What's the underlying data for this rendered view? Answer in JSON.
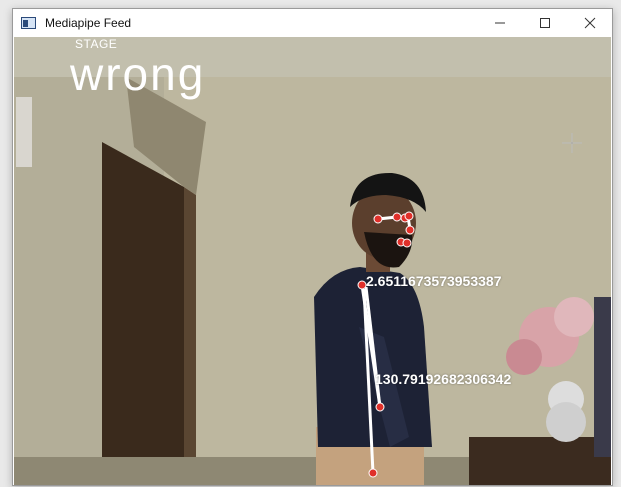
{
  "window": {
    "title": "Mediapipe Feed",
    "icon": "app-window-icon",
    "controls": [
      "minimize-icon",
      "maximize-icon",
      "close-icon"
    ]
  },
  "overlay": {
    "stage_label": "STAGE",
    "stage_value": "wrong",
    "angles": [
      "2.6511673573953387",
      "130.79192682306342"
    ]
  },
  "colors": {
    "landmark": "#e0302a",
    "connection": "#ffffff",
    "text": "#ffffff"
  }
}
